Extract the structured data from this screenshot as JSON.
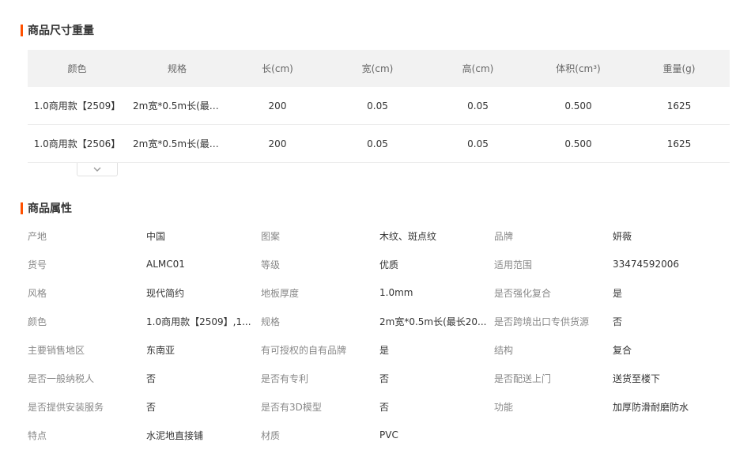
{
  "sections": {
    "size_title": "商品尺寸重量",
    "attrs_title": "商品属性"
  },
  "size_table": {
    "headers": [
      "颜色",
      "规格",
      "长(cm)",
      "宽(cm)",
      "高(cm)",
      "体积(cm³)",
      "重量(g)"
    ],
    "rows": [
      [
        "1.0商用款【2509】",
        "2m宽*0.5m长(最…",
        "200",
        "0.05",
        "0.05",
        "0.500",
        "1625"
      ],
      [
        "1.0商用款【2506】",
        "2m宽*0.5m长(最…",
        "200",
        "0.05",
        "0.05",
        "0.500",
        "1625"
      ]
    ]
  },
  "attributes": [
    [
      {
        "k": "产地",
        "v": "中国"
      },
      {
        "k": "图案",
        "v": "木纹、斑点纹"
      },
      {
        "k": "品牌",
        "v": "妍薇"
      }
    ],
    [
      {
        "k": "货号",
        "v": "ALMC01"
      },
      {
        "k": "等级",
        "v": "优质"
      },
      {
        "k": "适用范围",
        "v": "33474592006"
      }
    ],
    [
      {
        "k": "风格",
        "v": "现代简约"
      },
      {
        "k": "地板厚度",
        "v": "1.0mm"
      },
      {
        "k": "是否强化复合",
        "v": "是"
      }
    ],
    [
      {
        "k": "颜色",
        "v": "1.0商用款【2509】,1..."
      },
      {
        "k": "规格",
        "v": "2m宽*0.5m长(最长20..."
      },
      {
        "k": "是否跨境出口专供货源",
        "v": "否"
      }
    ],
    [
      {
        "k": "主要销售地区",
        "v": "东南亚"
      },
      {
        "k": "有可授权的自有品牌",
        "v": "是"
      },
      {
        "k": "结构",
        "v": "复合"
      }
    ],
    [
      {
        "k": "是否一般纳税人",
        "v": "否"
      },
      {
        "k": "是否有专利",
        "v": "否"
      },
      {
        "k": "是否配送上门",
        "v": "送货至楼下"
      }
    ],
    [
      {
        "k": "是否提供安装服务",
        "v": "否"
      },
      {
        "k": "是否有3D模型",
        "v": "否"
      },
      {
        "k": "功能",
        "v": "加厚防滑耐磨防水"
      }
    ],
    [
      {
        "k": "特点",
        "v": "水泥地直接铺"
      },
      {
        "k": "材质",
        "v": "PVC"
      },
      {
        "k": "",
        "v": ""
      }
    ]
  ],
  "colors": {
    "accent": "#ff5000",
    "header_bg": "#f2f2f2",
    "key_text": "#888888",
    "value_text": "#333333"
  },
  "icons": {
    "expand": "chevron-down-icon"
  }
}
